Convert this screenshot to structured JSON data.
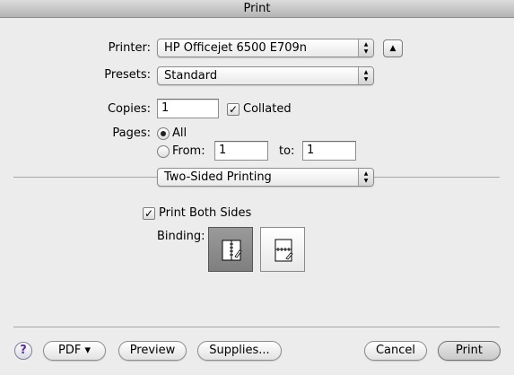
{
  "window": {
    "title": "Print"
  },
  "printer": {
    "label": "Printer:",
    "value": "HP Officejet 6500 E709n",
    "disclosure_icon": "triangle-up-icon"
  },
  "presets": {
    "label": "Presets:",
    "value": "Standard"
  },
  "copies": {
    "label": "Copies:",
    "value": "1",
    "collated_label": "Collated",
    "collated_checked": true
  },
  "pages": {
    "label": "Pages:",
    "all_label": "All",
    "all_selected": true,
    "from_label": "From:",
    "from_value": "1",
    "to_label": "to:",
    "to_value": "1"
  },
  "section": {
    "value": "Two-Sided Printing"
  },
  "two_sided": {
    "print_both_sides_label": "Print Both Sides",
    "print_both_sides_checked": true,
    "binding_label": "Binding:",
    "binding_selected": "long-edge",
    "binding_icons": [
      "long-edge-binding-icon",
      "short-edge-binding-icon"
    ]
  },
  "footer": {
    "help_label": "?",
    "pdf_label": "PDF ▾",
    "preview_label": "Preview",
    "supplies_label": "Supplies...",
    "cancel_label": "Cancel",
    "print_label": "Print"
  }
}
